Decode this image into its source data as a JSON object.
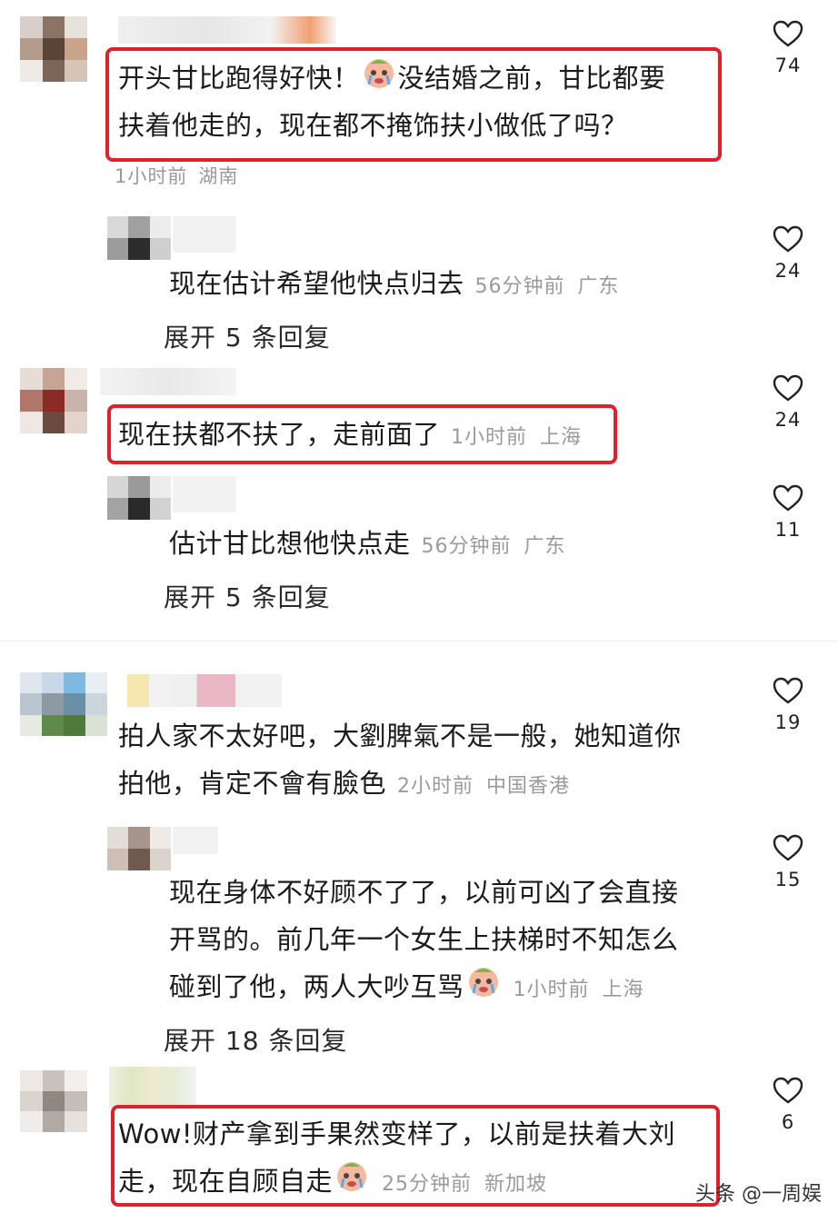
{
  "comments": [
    {
      "lines": [
        "开头甘比跑得好快！",
        "没结婚之前，甘比都要",
        "扶着他走的，现在都不掩饰扶小做低了吗？"
      ],
      "time": "1小时前",
      "location": "湖南",
      "likes": "74",
      "reply": {
        "text": "现在估计希望他快点归去",
        "time": "56分钟前",
        "location": "广东",
        "likes": "24"
      },
      "expand": "展开 5 条回复"
    },
    {
      "lines": [
        "现在扶都不扶了，走前面了"
      ],
      "time": "1小时前",
      "location": "上海",
      "likes": "24",
      "reply": {
        "text": "估计甘比想他快点走",
        "time": "56分钟前",
        "location": "广东",
        "likes": "11"
      },
      "expand": "展开 5 条回复"
    },
    {
      "lines": [
        "拍人家不太好吧，大劉脾氣不是一般，她知道你",
        "拍他，肯定不會有臉色"
      ],
      "time": "2小时前",
      "location": "中国香港",
      "likes": "19",
      "reply": {
        "lines": [
          "现在身体不好顾不了了，以前可凶了会直接",
          "开骂的。前几年一个女生上扶梯时不知怎么",
          "碰到了他，两人大吵互骂"
        ],
        "time": "1小时前",
        "location": "上海",
        "likes": "15"
      },
      "expand": "展开 18 条回复"
    },
    {
      "lines": [
        "Wow!财产拿到手果然变样了，以前是扶着大刘",
        "走，现在自顾自走"
      ],
      "time": "25分钟前",
      "location": "新加坡",
      "likes": "6"
    }
  ],
  "watermark": "头条 @一周娱",
  "colors": {
    "highlight": "#e0202a",
    "meta": "#9a9a9a"
  }
}
